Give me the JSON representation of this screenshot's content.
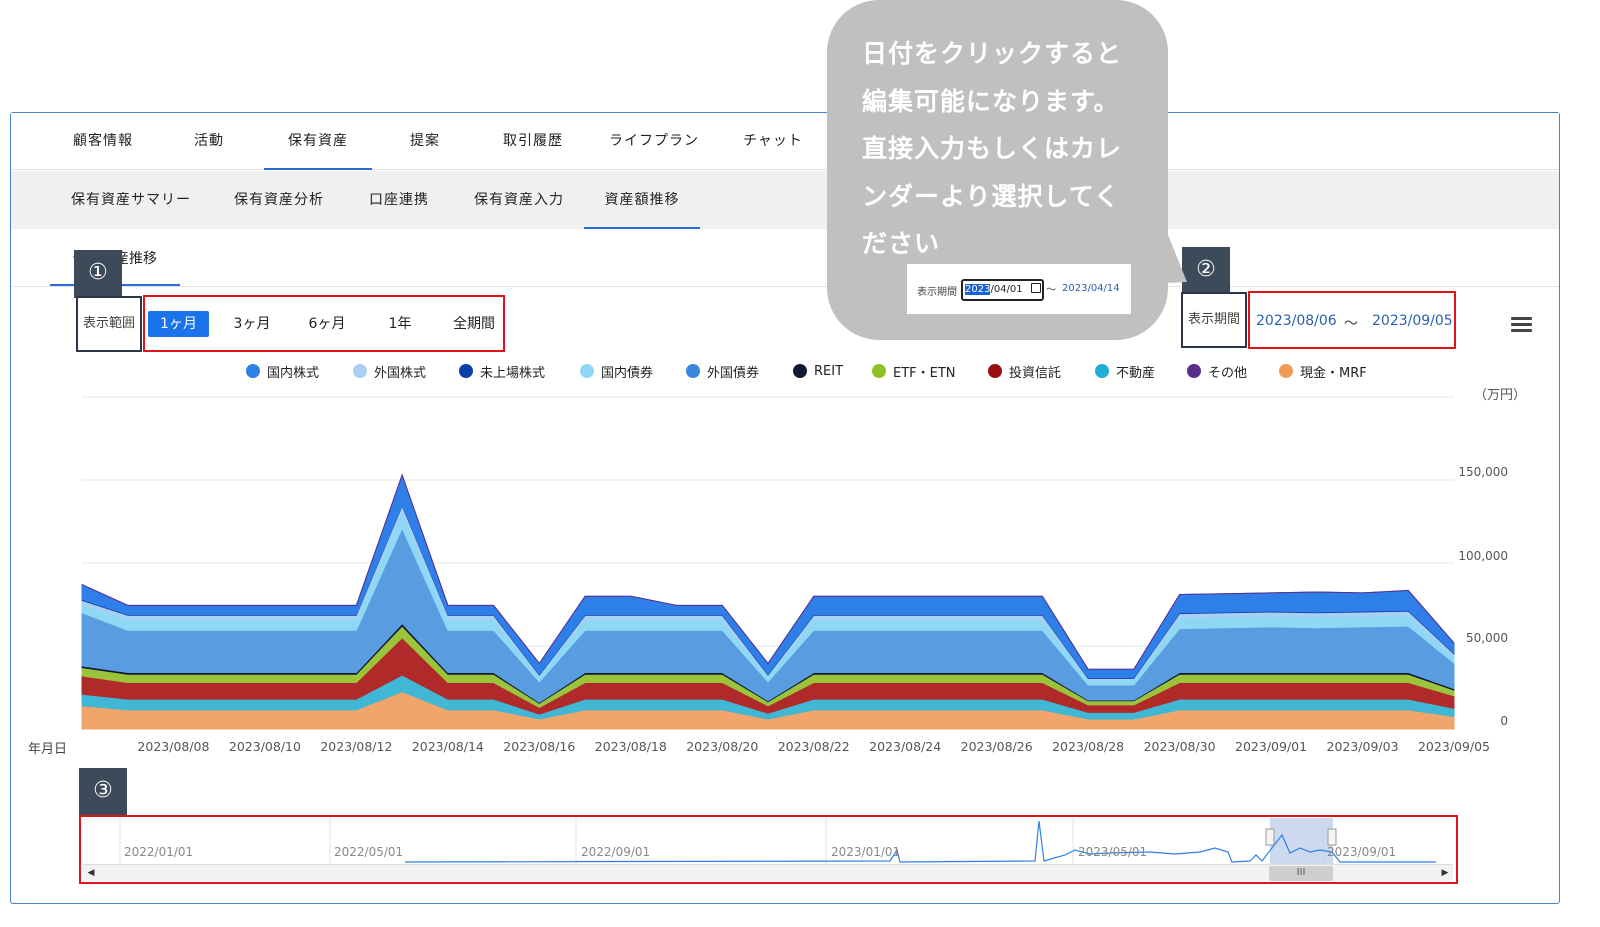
{
  "main_tabs": [
    {
      "label": "顧客情報"
    },
    {
      "label": "活動"
    },
    {
      "label": "保有資産"
    },
    {
      "label": "提案"
    },
    {
      "label": "取引履歴"
    },
    {
      "label": "ライフプラン"
    },
    {
      "label": "チャット"
    }
  ],
  "main_tab_active": "保有資産",
  "sub_tabs": [
    {
      "label": "保有資産サマリー"
    },
    {
      "label": "保有資産分析"
    },
    {
      "label": "口座連携"
    },
    {
      "label": "保有資産入力"
    },
    {
      "label": "資産額推移"
    }
  ],
  "sub_tab_active": "資産額推移",
  "page_tab": {
    "label": "保有資産推移"
  },
  "badges": {
    "one": "①",
    "two": "②",
    "three": "③"
  },
  "range": {
    "label": "表示範囲",
    "buttons": [
      {
        "label": "1ヶ月",
        "active": true
      },
      {
        "label": "3ヶ月"
      },
      {
        "label": "6ヶ月"
      },
      {
        "label": "1年"
      },
      {
        "label": "全期間"
      }
    ]
  },
  "period": {
    "label": "表示期間",
    "start": "2023/08/06",
    "tilde": "〜",
    "end": "2023/09/05"
  },
  "menu_icon": "hamburger-menu-icon",
  "bubble": {
    "lines": [
      "日付をクリックすると",
      "編集可能になります。",
      "直接入力もしくはカレ",
      "ンダーより選択してく",
      "ださい"
    ],
    "widget": {
      "label": "表示期間",
      "start_selected": "2023",
      "start_rest": "/04/01",
      "calendar_icon": "calendar-icon",
      "tilde": "〜",
      "end": "2023/04/14"
    }
  },
  "chart_data": {
    "type": "area",
    "stacked": true,
    "unit_label": "（万円）",
    "xlabel": "年月日",
    "ylim": [
      0,
      200000
    ],
    "yticks": [
      0,
      50000,
      100000,
      150000
    ],
    "ytick_labels": [
      "0",
      "50,000",
      "100,000",
      "150,000"
    ],
    "x": [
      "2023/08/06",
      "2023/08/07",
      "2023/08/08",
      "2023/08/09",
      "2023/08/10",
      "2023/08/11",
      "2023/08/12",
      "2023/08/13",
      "2023/08/14",
      "2023/08/15",
      "2023/08/16",
      "2023/08/17",
      "2023/08/18",
      "2023/08/19",
      "2023/08/20",
      "2023/08/21",
      "2023/08/22",
      "2023/08/23",
      "2023/08/24",
      "2023/08/25",
      "2023/08/26",
      "2023/08/27",
      "2023/08/28",
      "2023/08/29",
      "2023/08/30",
      "2023/08/31",
      "2023/09/01",
      "2023/09/02",
      "2023/09/03",
      "2023/09/04",
      "2023/09/05"
    ],
    "xtick_labels": [
      "2023/08/08",
      "2023/08/10",
      "2023/08/12",
      "2023/08/14",
      "2023/08/16",
      "2023/08/18",
      "2023/08/20",
      "2023/08/22",
      "2023/08/24",
      "2023/08/26",
      "2023/08/28",
      "2023/08/30",
      "2023/09/01",
      "2023/09/03",
      "2023/09/05"
    ],
    "legend_position": "top",
    "grid": true,
    "series": [
      {
        "name": "現金・MRF",
        "color": "#f2a56b",
        "values": [
          14000,
          11500,
          11500,
          11500,
          11500,
          11500,
          11500,
          22500,
          11500,
          11500,
          6000,
          11500,
          11500,
          11500,
          11500,
          6000,
          11500,
          11500,
          11500,
          11500,
          11500,
          11500,
          6000,
          6000,
          11500,
          11500,
          11500,
          11500,
          11500,
          11500,
          7500
        ]
      },
      {
        "name": "不動産",
        "color": "#40b7d4",
        "values": [
          7000,
          6500,
          6500,
          6500,
          6500,
          6500,
          6500,
          10000,
          6500,
          6500,
          3000,
          6500,
          6500,
          6500,
          6500,
          3500,
          6500,
          6500,
          6500,
          6500,
          6500,
          6500,
          4000,
          4000,
          6500,
          6500,
          6500,
          6500,
          6500,
          6500,
          5000
        ]
      },
      {
        "name": "投資信託",
        "color": "#b02a2a",
        "values": [
          11000,
          10000,
          10000,
          10000,
          10000,
          10000,
          10000,
          22500,
          10000,
          10000,
          4000,
          10000,
          10000,
          10000,
          10000,
          4500,
          10000,
          10000,
          10000,
          10000,
          10000,
          10000,
          4500,
          4500,
          10000,
          10000,
          10000,
          10000,
          10000,
          10000,
          7500
        ]
      },
      {
        "name": "ETF・ETN",
        "color": "#9cc43b",
        "values": [
          5000,
          5000,
          5000,
          5000,
          5000,
          5000,
          5000,
          7000,
          5000,
          5000,
          2500,
          5000,
          5000,
          5000,
          5000,
          2500,
          5000,
          5000,
          5000,
          5000,
          5000,
          5000,
          2500,
          2500,
          5000,
          5000,
          5000,
          5000,
          5000,
          5000,
          3500
        ]
      },
      {
        "name": "REIT",
        "color": "#0e1a33",
        "values": [
          1000,
          1000,
          1000,
          1000,
          1000,
          1000,
          1000,
          1500,
          1000,
          1000,
          500,
          1000,
          1000,
          1000,
          1000,
          500,
          1000,
          1000,
          1000,
          1000,
          1000,
          1000,
          500,
          500,
          1000,
          1000,
          1000,
          1000,
          1000,
          1000,
          800
        ]
      },
      {
        "name": "外国債券",
        "color": "#5a9ce0",
        "values": [
          32000,
          25500,
          25500,
          25500,
          25500,
          25500,
          25500,
          57500,
          25500,
          25500,
          12500,
          25500,
          25500,
          25500,
          25500,
          11500,
          25500,
          25500,
          25500,
          25500,
          25500,
          25500,
          9000,
          9000,
          26500,
          27000,
          27500,
          27000,
          27500,
          28000,
          15500
        ]
      },
      {
        "name": "国内債券",
        "color": "#8ed8f5",
        "values": [
          5000,
          6500,
          6500,
          6500,
          6500,
          6500,
          6500,
          10000,
          6500,
          6500,
          3000,
          6500,
          6500,
          6500,
          6500,
          3000,
          6500,
          6500,
          6500,
          6500,
          6500,
          6500,
          3000,
          3000,
          6500,
          6500,
          6500,
          6500,
          6500,
          6500,
          4000
        ]
      },
      {
        "name": "外国株式",
        "color": "#a9d0f2",
        "values": [
          2500,
          2500,
          2500,
          2500,
          2500,
          2500,
          2500,
          3500,
          2500,
          2500,
          1000,
          2500,
          2500,
          2500,
          2500,
          1000,
          2500,
          2500,
          2500,
          2500,
          2500,
          2500,
          1000,
          1000,
          2500,
          2500,
          2500,
          2500,
          2500,
          2500,
          1500
        ]
      },
      {
        "name": "未上場株式",
        "color": "#0b3fa8",
        "values": [
          500,
          500,
          500,
          500,
          500,
          500,
          500,
          500,
          500,
          500,
          500,
          500,
          500,
          500,
          500,
          500,
          500,
          500,
          500,
          500,
          500,
          500,
          500,
          500,
          500,
          500,
          500,
          500,
          500,
          500,
          500
        ]
      },
      {
        "name": "国内株式",
        "color": "#2f7fe8",
        "values": [
          9000,
          5500,
          5500,
          5500,
          5500,
          5500,
          5500,
          18000,
          5500,
          5500,
          6500,
          11000,
          11000,
          5500,
          5500,
          6500,
          11000,
          11000,
          11000,
          11000,
          11000,
          11000,
          5000,
          5000,
          11000,
          11000,
          11000,
          12000,
          11000,
          12000,
          6000
        ]
      },
      {
        "name": "その他",
        "color": "#5b2d8a",
        "values": [
          0,
          0,
          0,
          0,
          0,
          0,
          0,
          0,
          0,
          0,
          0,
          0,
          0,
          0,
          0,
          0,
          0,
          0,
          0,
          0,
          0,
          0,
          0,
          0,
          0,
          0,
          0,
          0,
          0,
          0,
          0
        ]
      }
    ],
    "legend": [
      {
        "name": "国内株式",
        "color": "#2f7fe8"
      },
      {
        "name": "外国株式",
        "color": "#a9d0f2"
      },
      {
        "name": "未上場株式",
        "color": "#0b3fa8"
      },
      {
        "name": "国内債券",
        "color": "#8ed8f5"
      },
      {
        "name": "外国債券",
        "color": "#3a86dc"
      },
      {
        "name": "REIT",
        "color": "#0e1a33"
      },
      {
        "name": "ETF・ETN",
        "color": "#8dc022"
      },
      {
        "name": "投資信託",
        "color": "#9a1010"
      },
      {
        "name": "不動産",
        "color": "#22aed3"
      },
      {
        "name": "その他",
        "color": "#5b2d8a"
      },
      {
        "name": "現金・MRF",
        "color": "#f29a57"
      }
    ]
  },
  "navigator": {
    "tick_labels": [
      "2022/01/01",
      "2022/05/01",
      "2022/09/01",
      "2023/01/01",
      "2023/05/01",
      "2023/09/01"
    ],
    "selected_range": [
      "2023/08/06",
      "2023/09/05"
    ],
    "scroll_left_icon": "arrow-left-icon",
    "scroll_right_icon": "arrow-right-icon",
    "scroll_thumb_icon": "grip-icon",
    "scroll_thumb_label": "III"
  }
}
